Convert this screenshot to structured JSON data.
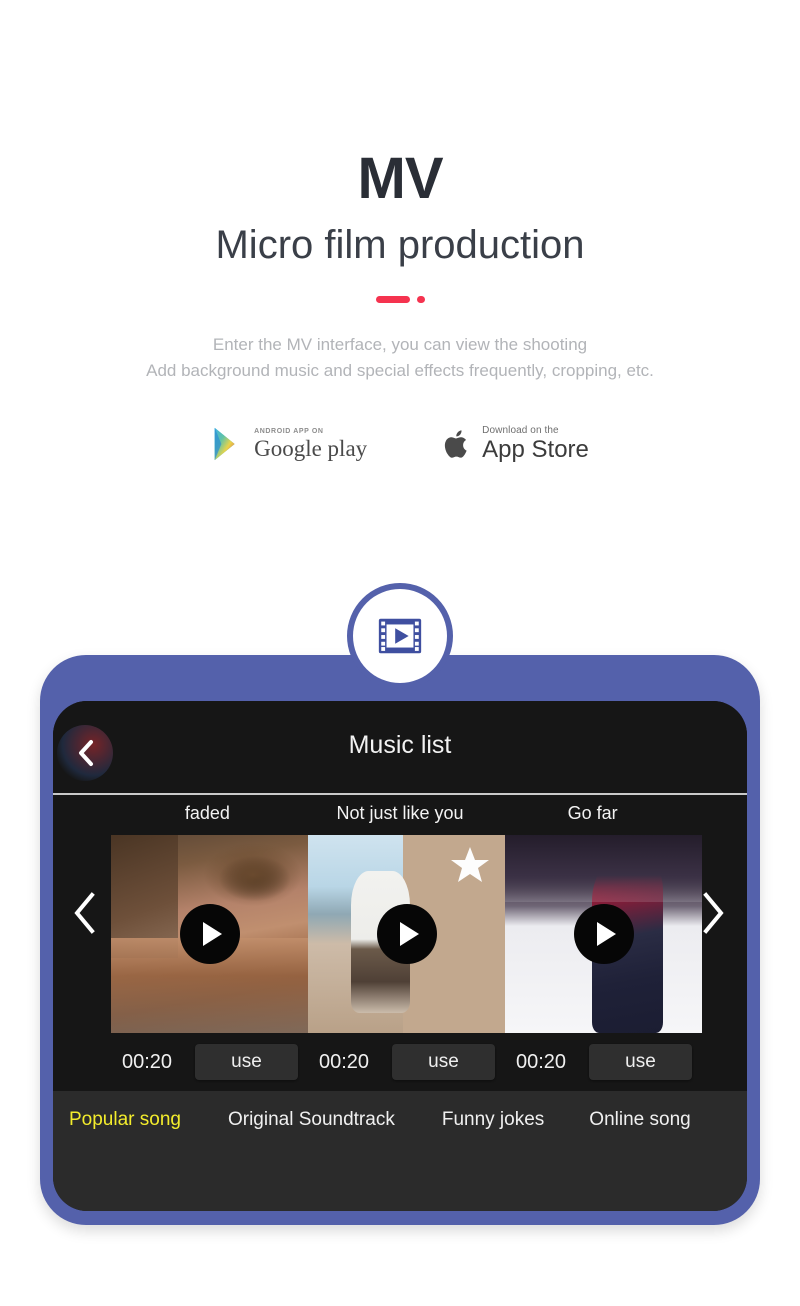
{
  "hero": {
    "logo": "MV",
    "title": "Micro film production",
    "desc_line1": "Enter the MV interface, you can view the shooting",
    "desc_line2": "Add background music and special effects frequently, cropping, etc.",
    "accent_color": "#f5334f"
  },
  "stores": [
    {
      "icon": "google-play-icon",
      "small": "ANDROID APP ON",
      "big": "Google play"
    },
    {
      "icon": "apple-logo-icon",
      "small": "Download on the",
      "big": "App Store"
    }
  ],
  "badge_icon": "film-strip-play-icon",
  "device": {
    "frame_color": "#5461ab",
    "screen_color": "#161616",
    "header": {
      "back_icon": "chevron-left-icon",
      "title": "Music list"
    },
    "carousel": {
      "prev_icon": "chevron-left-icon",
      "next_icon": "chevron-right-icon",
      "items": [
        {
          "title": "faded",
          "art": "art-books",
          "play_icon": "play-icon",
          "duration": "00:20",
          "action_label": "use",
          "has_star": false
        },
        {
          "title": "Not just like you",
          "art": "art-boy",
          "play_icon": "play-icon",
          "duration": "00:20",
          "action_label": "use",
          "has_star": true
        },
        {
          "title": "Go far",
          "art": "art-snow",
          "play_icon": "play-icon",
          "duration": "00:20",
          "action_label": "use",
          "has_star": false
        }
      ]
    },
    "tabs": {
      "active_color": "#f3ec2c",
      "items": [
        {
          "label": "Popular song",
          "active": true
        },
        {
          "label": "Original Soundtrack",
          "active": false
        },
        {
          "label": "Funny jokes",
          "active": false
        },
        {
          "label": "Online song",
          "active": false
        }
      ]
    }
  }
}
